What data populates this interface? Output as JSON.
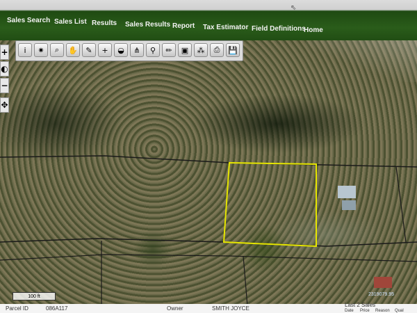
{
  "nav": {
    "items": [
      "Sales Search",
      "Sales List",
      "Results",
      "Sales Results",
      "Report",
      "Tax Estimator",
      "Field Definitions",
      "Home"
    ]
  },
  "toolbar": {
    "tools": [
      {
        "icon": "info-icon",
        "glyph": "i"
      },
      {
        "icon": "select-star-icon",
        "glyph": "✷"
      },
      {
        "icon": "zoom-magnifier-icon",
        "glyph": "⌕"
      },
      {
        "icon": "pan-hand-icon",
        "glyph": "✋"
      },
      {
        "icon": "eraser-icon",
        "glyph": "✎"
      },
      {
        "icon": "add-layer-icon",
        "glyph": "+"
      },
      {
        "icon": "globe-icon",
        "glyph": "◒"
      },
      {
        "icon": "network-icon",
        "glyph": "⋔"
      },
      {
        "icon": "search-icon",
        "glyph": "⚲"
      },
      {
        "icon": "pencil-icon",
        "glyph": "✏"
      },
      {
        "icon": "extent-icon",
        "glyph": "▣"
      },
      {
        "icon": "buffer-icon",
        "glyph": "⁂"
      },
      {
        "icon": "print-icon",
        "glyph": "⎙"
      },
      {
        "icon": "save-icon",
        "glyph": "💾"
      }
    ]
  },
  "zoom": {
    "plus": "+",
    "minus": "−",
    "pan": "✥",
    "full": "◐"
  },
  "map": {
    "scale_label": "100 ft",
    "coord_label": "2319079.95",
    "selection_color": "#e6e600"
  },
  "parcel": {
    "parcel_id_label": "Parcel ID",
    "parcel_id": "086A117",
    "owner_label": "Owner",
    "owner": "SMITH JOYCE",
    "sales_label": "Last 2 Sales",
    "col_date": "Date",
    "col_price": "Price",
    "col_reason": "Reason",
    "col_qual": "Qual"
  }
}
